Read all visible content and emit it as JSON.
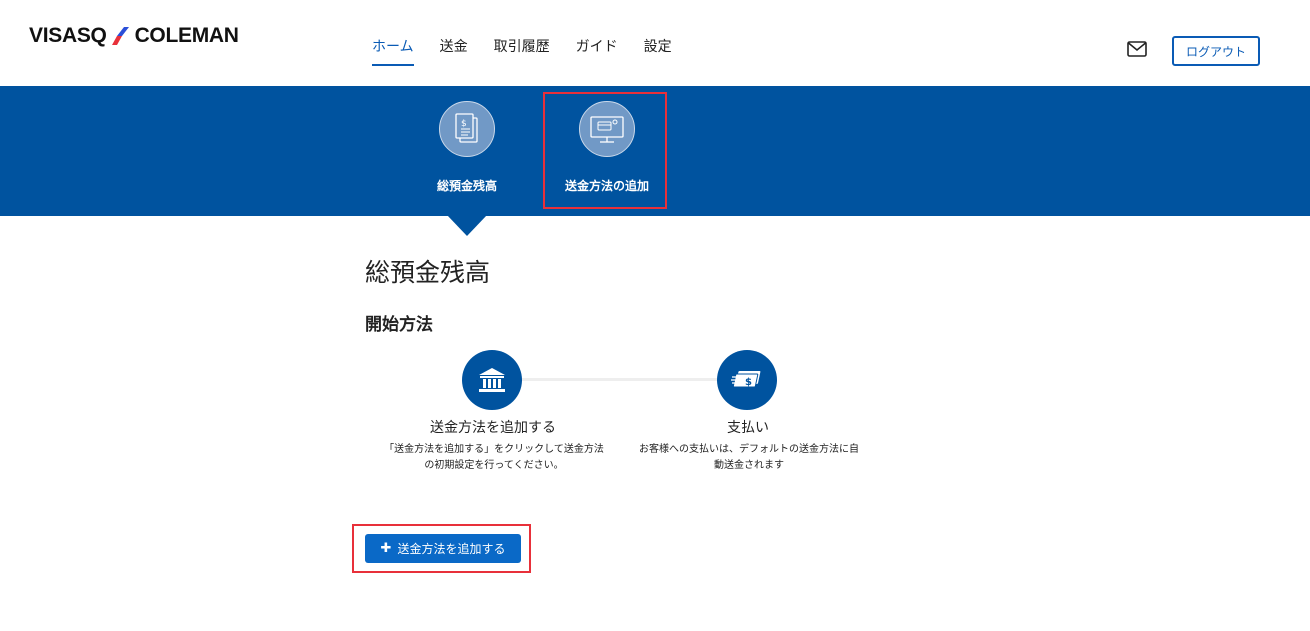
{
  "colors": {
    "brand_blue": "#00539f",
    "link_blue": "#0a5bb5",
    "button_blue": "#0a69c7",
    "highlight_red": "#e8303a"
  },
  "header": {
    "logo_left": "VISASQ",
    "logo_right": "COLEMAN",
    "nav": [
      {
        "label": "ホーム",
        "active": true
      },
      {
        "label": "送金"
      },
      {
        "label": "取引履歴"
      },
      {
        "label": "ガイド"
      },
      {
        "label": "設定"
      }
    ],
    "mail_icon": "envelope-icon",
    "logout_label": "ログアウト"
  },
  "banner": {
    "items": [
      {
        "label": "総預金残高",
        "icon": "document-dollar-icon"
      },
      {
        "label": "送金方法の追加",
        "icon": "monitor-card-icon"
      }
    ]
  },
  "main": {
    "page_title": "総預金残高",
    "section_title": "開始方法",
    "steps": [
      {
        "title": "送金方法を追加する",
        "desc": "「送金方法を追加する」をクリックして送金方法の初期設定を行ってください。",
        "icon": "bank-icon"
      },
      {
        "title": "支払い",
        "desc": "お客様への支払いは、デフォルトの送金方法に自動送金されます",
        "icon": "money-stack-icon"
      }
    ],
    "add_button_label": "送金方法を追加する",
    "add_button_icon": "plus-icon"
  }
}
